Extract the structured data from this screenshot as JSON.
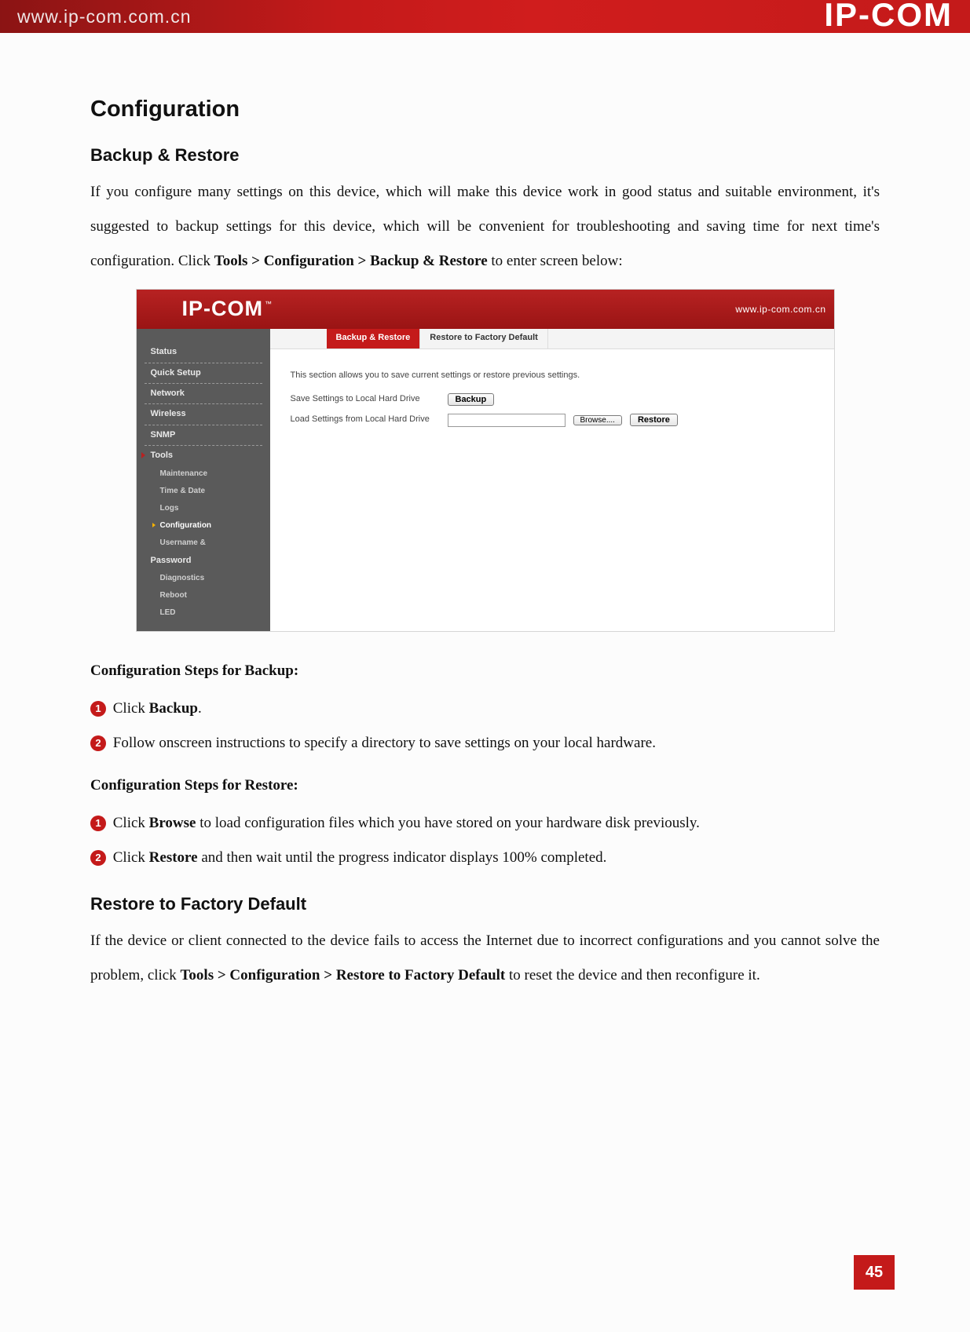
{
  "banner": {
    "url": "www.ip-com.com.cn",
    "logo": "IP-COM"
  },
  "h1": "Configuration",
  "h2a": "Backup & Restore",
  "intro_pre": "If you configure many settings on this device, which will make this device work in good status and suitable environment, it's suggested to backup settings for this device, which will be convenient for troubleshooting and saving time for next time's configuration. Click ",
  "intro_path": "Tools > Configuration > Backup & Restore",
  "intro_post": " to enter screen below:",
  "shot": {
    "logo": "IP-COM",
    "url": "www.ip-com.com.cn",
    "nav": {
      "status": "Status",
      "quick": "Quick Setup",
      "network": "Network",
      "wireless": "Wireless",
      "snmp": "SNMP",
      "tools": "Tools",
      "maintenance": "Maintenance",
      "timedate": "Time & Date",
      "logs": "Logs",
      "configuration": "Configuration",
      "username": "Username &",
      "password": "Password",
      "diagnostics": "Diagnostics",
      "reboot": "Reboot",
      "led": "LED"
    },
    "tabs": {
      "active": "Backup & Restore",
      "inactive": "Restore to Factory Default"
    },
    "desc": "This section allows you to save current settings or restore previous settings.",
    "row1label": "Save Settings to Local Hard Drive",
    "row1btn": "Backup",
    "row2label": "Load Settings from Local Hard Drive",
    "browse": "Browse....",
    "restore": "Restore"
  },
  "steps_backup_head": "Configuration Steps for Backup:",
  "step_b1_pre": " Click ",
  "step_b1_bold": "Backup",
  "step_b1_post": ".",
  "step_b2": " Follow onscreen instructions to specify a directory to save settings on your local hardware.",
  "steps_restore_head": "Configuration Steps for Restore:",
  "step_r1_pre": " Click ",
  "step_r1_bold": "Browse",
  "step_r1_post": " to load configuration files which you have stored on your hardware disk previously.",
  "step_r2_pre": " Click ",
  "step_r2_bold": "Restore",
  "step_r2_post": " and then wait until the progress indicator displays 100% completed.",
  "h2b": "Restore to Factory Default",
  "factory_pre": "If the device or client connected to the device fails to access the Internet due to incorrect configurations and you cannot solve the problem, click ",
  "factory_path": "Tools > Configuration > Restore to Factory Default",
  "factory_post": " to reset the device and then reconfigure it.",
  "pagenum": "45",
  "nums": {
    "one": "1",
    "two": "2"
  }
}
